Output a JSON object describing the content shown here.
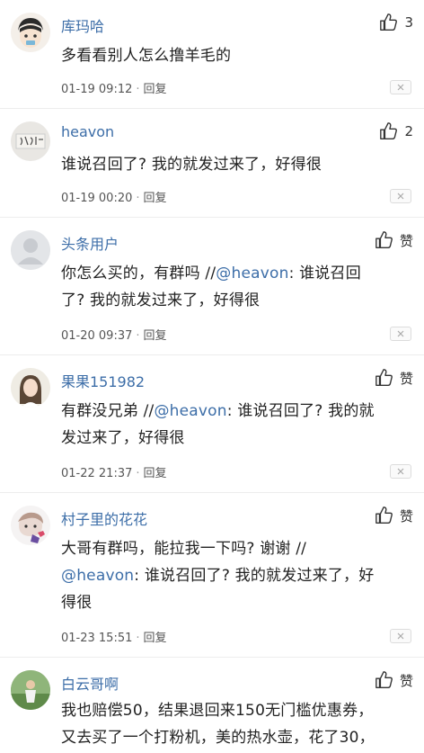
{
  "comments": [
    {
      "username": "库玛哈",
      "like_label": "3",
      "lines": [
        "多看看别人怎么撸羊毛的"
      ],
      "time": "01-19 09:12",
      "reply_label": "回复",
      "avatar": "cartoon-face-avatar"
    },
    {
      "username": "heavon",
      "like_label": "2",
      "lines": [
        "谁说召回了? 我的就发过来了，好得很"
      ],
      "time": "01-19 00:20",
      "reply_label": "回复",
      "avatar": "calligraphy-avatar"
    },
    {
      "username": "头条用户",
      "like_label": "赞",
      "lines_parts": [
        {
          "pre": "你怎么买的，有群吗 //",
          "mention": "@heavon",
          "post": ": 谁说召回"
        },
        {
          "pre": "了? 我的就发过来了，好得很",
          "mention": "",
          "post": ""
        }
      ],
      "time": "01-20 09:37",
      "reply_label": "回复",
      "avatar": "default-user-avatar"
    },
    {
      "username": "果果151982",
      "like_label": "赞",
      "lines_parts": [
        {
          "pre": "有群没兄弟 //",
          "mention": "@heavon",
          "post": ": 谁说召回了? 我的就"
        },
        {
          "pre": "发过来了，好得很",
          "mention": "",
          "post": ""
        }
      ],
      "time": "01-22 21:37",
      "reply_label": "回复",
      "avatar": "girl-photo-avatar"
    },
    {
      "username": "村子里的花花",
      "like_label": "赞",
      "lines_parts": [
        {
          "pre": "大哥有群吗，能拉我一下吗? 谢谢 //",
          "mention": "",
          "post": ""
        },
        {
          "pre": "",
          "mention": "@heavon",
          "post": ": 谁说召回了? 我的就发过来了，好"
        },
        {
          "pre": "得很",
          "mention": "",
          "post": ""
        }
      ],
      "time": "01-23 15:51",
      "reply_label": "回复",
      "avatar": "cartoon-girl-avatar"
    },
    {
      "username": "白云哥啊",
      "like_label": "赞",
      "lines": [
        "我也赔偿50，结果退回来150无门槛优惠券，",
        "又去买了一个打粉机，美的热水壶，花了30，"
      ],
      "avatar": "outdoor-photo-avatar"
    }
  ],
  "colors": {
    "username": "#3d6ea8",
    "mention": "#3d6ea8",
    "text": "#222222",
    "meta": "#555555"
  }
}
